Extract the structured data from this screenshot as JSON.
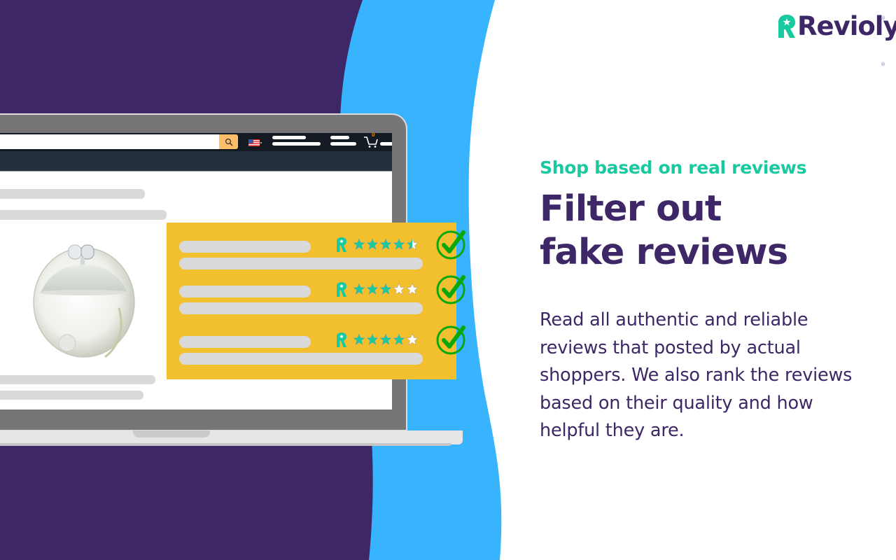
{
  "colors": {
    "purple": "#3d2766",
    "sky_blue": "#38b4ff",
    "teal": "#19c9a0",
    "card_yellow": "#f2c02f",
    "check_green": "#0aa80a",
    "navbar_dark": "#131a22",
    "subnav_dark": "#232f3e",
    "search_orange": "#febd69"
  },
  "brand": {
    "name": "Revioly",
    "registered_mark": "®",
    "logo_icon": "revioly-r-star-logo"
  },
  "hero": {
    "kicker": "Shop based on real reviews",
    "headline_line1": "Filter out",
    "headline_line2": "fake reviews",
    "body": "Read all authentic and reliable reviews that posted by actual shoppers. We also rank the reviews based on their quality and how helpful they are."
  },
  "mock_store": {
    "search_icon": "search-icon",
    "locale_icon": "us-flag-icon",
    "cart_icon": "shopping-cart-icon",
    "cart_count": "0",
    "product_image": "perfume-bottle"
  },
  "reviews": [
    {
      "rating": 4.5,
      "max": 5,
      "verified": true
    },
    {
      "rating": 3,
      "max": 5,
      "verified": true
    },
    {
      "rating": 4,
      "max": 5,
      "verified": true
    }
  ]
}
